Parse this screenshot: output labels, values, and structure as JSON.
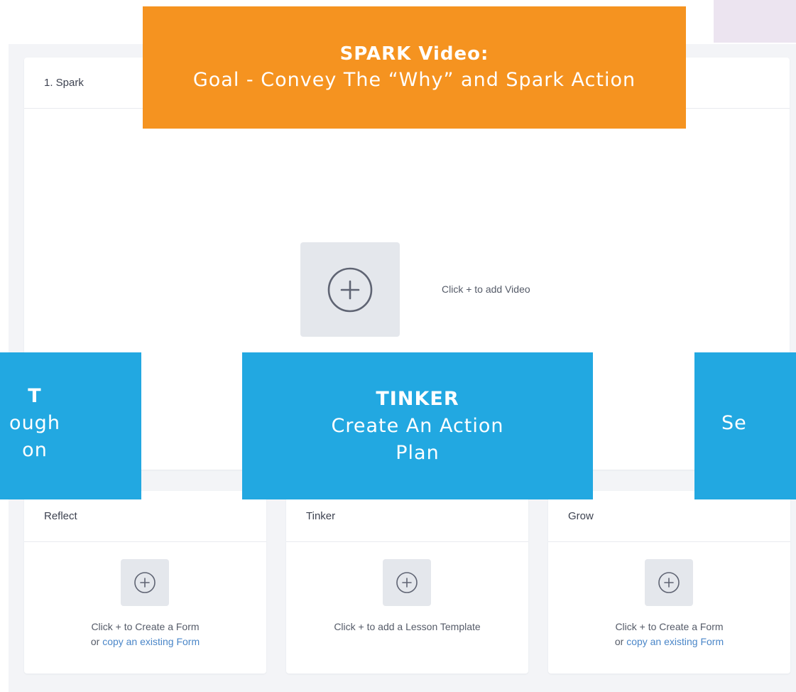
{
  "spark_card": {
    "header": "1. Spark",
    "add_video_text": "Click + to add Video"
  },
  "cards": {
    "reflect": {
      "header": "Reflect",
      "note_line1": "Click + to Create a Form",
      "note_or": "or ",
      "note_link": "copy an existing Form"
    },
    "tinker": {
      "header": "Tinker",
      "note_line1": "Click + to add a Lesson Template"
    },
    "grow": {
      "header": "Grow",
      "note_line1": "Click + to Create a Form",
      "note_or": "or ",
      "note_link": "copy an existing Form"
    }
  },
  "banners": {
    "spark": {
      "title": "SPARK Video:",
      "subtitle": "Goal - Convey The “Why” and Spark Action"
    },
    "left_partial": {
      "line1": "T",
      "line2": "ough",
      "line3": "on"
    },
    "tinker": {
      "title": "TINKER",
      "line1": "Create An Action",
      "line2": "Plan"
    },
    "right_partial": {
      "line1": "Se"
    }
  },
  "colors": {
    "orange_banner": "#f59320",
    "blue_banner": "#22a8e1",
    "link": "#4a86c8",
    "tile": "#e4e7ec",
    "workspace": "#f3f4f7"
  },
  "icons": {
    "add": "plus-circle-icon"
  }
}
